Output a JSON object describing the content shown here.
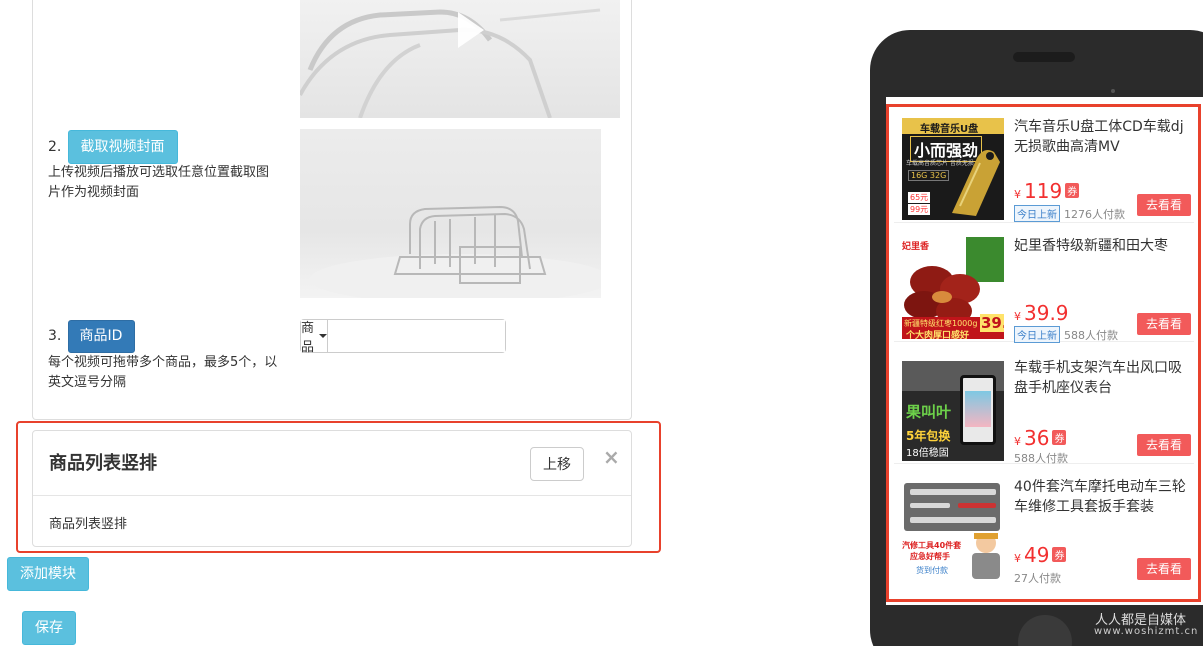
{
  "step2": {
    "num": "2.",
    "button": "截取视频封面",
    "desc": "上传视频后播放可选取任意位置截取图片作为视频封面"
  },
  "step3": {
    "num": "3.",
    "button": "商品ID",
    "desc": "每个视频可拖带多个商品，最多5个，以英文逗号分隔",
    "dropdown": "商品",
    "input_value": ""
  },
  "module": {
    "title": "商品列表竖排",
    "move_up": "上移",
    "close": "×",
    "body": "商品列表竖排"
  },
  "actions": {
    "add_module": "添加模块",
    "save": "保存"
  },
  "products": [
    {
      "title": "汽车音乐U盘工体CD车载dj无损歌曲高清MV",
      "yen": "¥",
      "price": "119",
      "coupon": "券",
      "new_tag": "今日上新",
      "buyers": "1276人付款",
      "button": "去看看",
      "img_top_text": "车载音乐U盘",
      "img_big_text": "小而强劲",
      "img_sub_text": "车载高音质芯片 音质无损",
      "img_spec": "16G 32G",
      "img_price": "99元",
      "img_price2": "65元"
    },
    {
      "title": "妃里香特级新疆和田大枣",
      "yen": "¥",
      "price": "39.9",
      "coupon": "",
      "new_tag": "今日上新",
      "buyers": "588人付款",
      "button": "去看看",
      "img_brand": "妃里香",
      "img_banner": "新疆特级红枣1000g",
      "img_banner2": "个大肉厚口感好",
      "img_price": "39."
    },
    {
      "title": "车载手机支架汽车出风口吸盘手机座仪表台",
      "yen": "¥",
      "price": "36",
      "coupon": "券",
      "new_tag": "",
      "buyers": "588人付款",
      "button": "去看看",
      "img_brand": "果叫叶",
      "img_badge": "5年包换",
      "img_badge2": "18倍稳固"
    },
    {
      "title": "40件套汽车摩托电动车三轮车维修工具套扳手套装",
      "yen": "¥",
      "price": "49",
      "coupon": "券",
      "new_tag": "",
      "buyers": "27人付款",
      "button": "去看看",
      "img_caption": "汽修工具40件套",
      "img_caption2": "应急好帮手",
      "img_caption3": "货到付款"
    }
  ],
  "watermark": {
    "text": "人人都是自媒体",
    "url": "www.woshizmt.cn"
  },
  "colors": {
    "highlight": "#e8412c",
    "info": "#5bc0de",
    "primary": "#337ab7",
    "price": "#f23030",
    "buy": "#f25a5a"
  }
}
